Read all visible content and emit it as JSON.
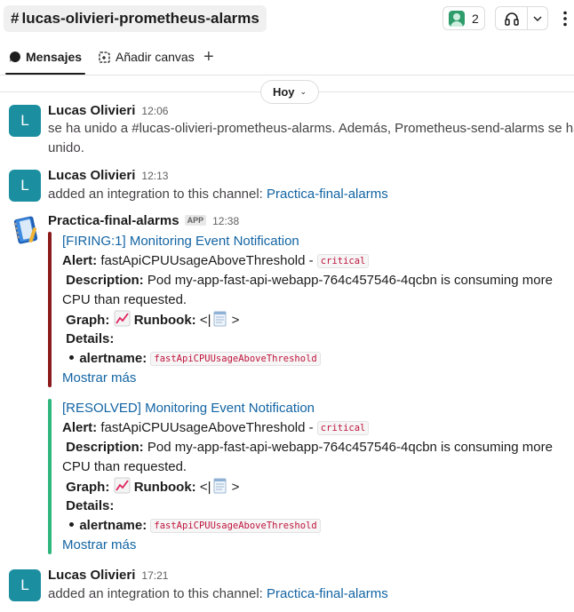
{
  "channel": {
    "hash": "#",
    "name": "lucas-olivieri-prometheus-alarms"
  },
  "header": {
    "member_count": "2"
  },
  "tabs": {
    "messages": "Mensajes",
    "canvas": "Añadir canvas",
    "add": "+"
  },
  "date_divider": {
    "label": "Hoy"
  },
  "messages": [
    {
      "avatar_letter": "L",
      "sender": "Lucas Olivieri",
      "time": "12:06",
      "text_line1": "se ha unido a #lucas-olivieri-prometheus-alarms. Además, Prometheus-send-alarms se ha",
      "text_line2": "unido."
    },
    {
      "avatar_letter": "L",
      "sender": "Lucas Olivieri",
      "time": "12:13",
      "text": "added an integration to this channel: ",
      "link": "Practica-final-alarms"
    },
    {
      "sender": "Practica-final-alarms",
      "badge": "APP",
      "time": "12:38",
      "attachments": [
        {
          "color": "#8b1a1a",
          "title": "[FIRING:1] Monitoring Event Notification",
          "alert_label": "Alert:",
          "alert_value": " fastApiCPUUsageAboveThreshold - ",
          "severity": "critical",
          "description_label": "Description:",
          "description_line1": " Pod my-app-fast-api-webapp-764c457546-4qcbn is consuming more",
          "description_line2": "CPU than requested.",
          "graph_label": "Graph:",
          "runbook_label": "Runbook:",
          "runbook_open": " <|",
          "runbook_close": ">",
          "details_label": "Details:",
          "alertname_label": "alertname:",
          "alertname_value": "fastApiCPUUsageAboveThreshold",
          "show_more": "Mostrar más"
        },
        {
          "color": "#2eb67d",
          "title": "[RESOLVED] Monitoring Event Notification",
          "alert_label": "Alert:",
          "alert_value": " fastApiCPUUsageAboveThreshold - ",
          "severity": "critical",
          "description_label": "Description:",
          "description_line1": " Pod my-app-fast-api-webapp-764c457546-4qcbn is consuming more",
          "description_line2": "CPU than requested.",
          "graph_label": "Graph:",
          "runbook_label": "Runbook:",
          "runbook_open": " <|",
          "runbook_close": ">",
          "details_label": "Details:",
          "alertname_label": "alertname:",
          "alertname_value": "fastApiCPUUsageAboveThreshold",
          "show_more": "Mostrar más"
        }
      ]
    },
    {
      "avatar_letter": "L",
      "sender": "Lucas Olivieri",
      "time": "17:21",
      "text": "added an integration to this channel: ",
      "link": "Practica-final-alarms"
    }
  ],
  "icons": {
    "members": "user-avatar-icon",
    "huddle": "headphones-icon",
    "more": "kebab-icon",
    "messages_tab": "chat-bubble-icon",
    "canvas_tab": "canvas-icon",
    "graph": "chart-increasing-emoji",
    "runbook": "notepad-emoji",
    "bot": "notebook-app-icon"
  }
}
